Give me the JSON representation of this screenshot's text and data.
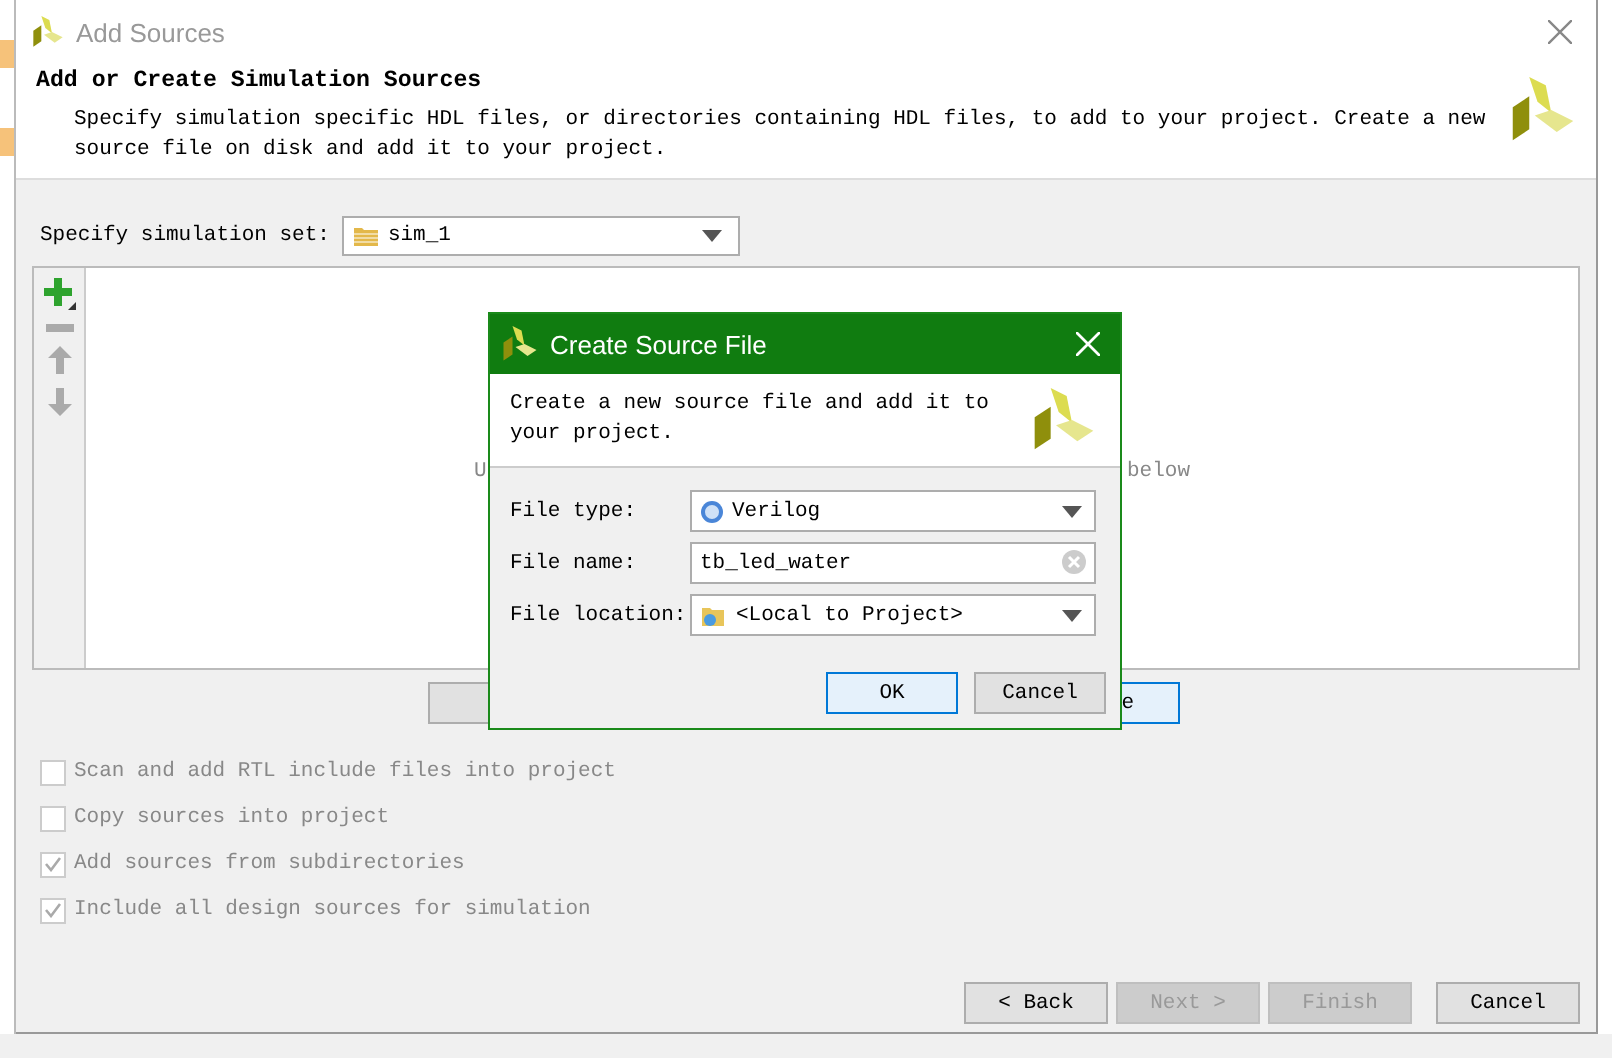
{
  "window": {
    "title": "Add Sources"
  },
  "header": {
    "heading": "Add or Create Simulation Sources",
    "description": "Specify simulation specific HDL files, or directories containing HDL files, to add to your project. Create a new source file on disk and add it to your project."
  },
  "simulation_set": {
    "label": "Specify simulation set:",
    "value": "sim_1"
  },
  "file_list": {
    "hint_start": "U",
    "hint_end": "below",
    "button_end": "e"
  },
  "options": [
    {
      "label": "Scan and add RTL include files into project",
      "checked": false,
      "disabled": true
    },
    {
      "label": "Copy sources into project",
      "checked": false,
      "disabled": true
    },
    {
      "label": "Add sources from subdirectories",
      "checked": true,
      "disabled": true
    },
    {
      "label": "Include all design sources for simulation",
      "checked": true,
      "disabled": true
    }
  ],
  "buttons": [
    {
      "label": "< Back",
      "disabled": false
    },
    {
      "label": "Next >",
      "disabled": true
    },
    {
      "label": "Finish",
      "disabled": true
    },
    {
      "label": "Cancel",
      "disabled": false
    }
  ],
  "dialog": {
    "title": "Create Source File",
    "description": "Create a new source file and add it to your project.",
    "fields": [
      {
        "kind": "dropdown",
        "label": "File type:",
        "value": "Verilog"
      },
      {
        "kind": "text",
        "label": "File name:",
        "value": "tb_led_water"
      },
      {
        "kind": "location",
        "label": "File location:",
        "value": "<Local to Project>"
      }
    ],
    "buttons": [
      {
        "label": "OK",
        "selected": true
      },
      {
        "label": "Cancel",
        "selected": false
      }
    ]
  }
}
